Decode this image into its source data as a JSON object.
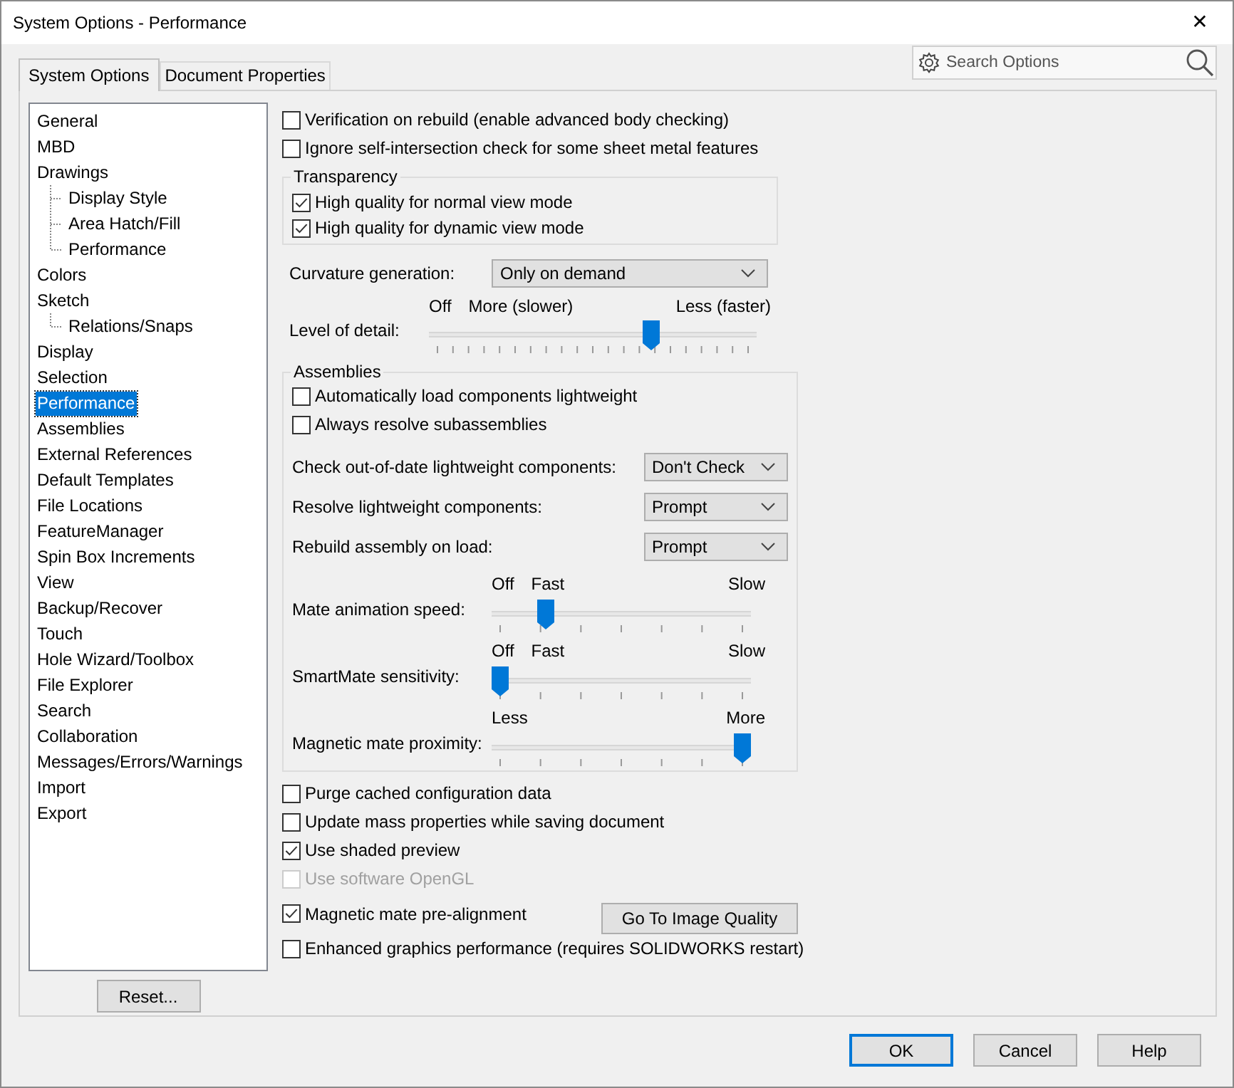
{
  "window": {
    "title": "System Options - Performance",
    "close": "✕"
  },
  "tabs": [
    {
      "label": "System Options",
      "selected": true
    },
    {
      "label": "Document Properties",
      "selected": false
    }
  ],
  "search": {
    "placeholder": "Search Options"
  },
  "tree": [
    {
      "label": "General",
      "selected": false
    },
    {
      "label": "MBD",
      "selected": false
    },
    {
      "label": "Drawings",
      "selected": false,
      "children": [
        {
          "label": "Display Style",
          "selected": false
        },
        {
          "label": "Area Hatch/Fill",
          "selected": false
        },
        {
          "label": "Performance",
          "selected": false
        }
      ]
    },
    {
      "label": "Colors",
      "selected": false
    },
    {
      "label": "Sketch",
      "selected": false,
      "children": [
        {
          "label": "Relations/Snaps",
          "selected": false
        }
      ]
    },
    {
      "label": "Display",
      "selected": false
    },
    {
      "label": "Selection",
      "selected": false
    },
    {
      "label": "Performance",
      "selected": true
    },
    {
      "label": "Assemblies",
      "selected": false
    },
    {
      "label": "External References",
      "selected": false
    },
    {
      "label": "Default Templates",
      "selected": false
    },
    {
      "label": "File Locations",
      "selected": false
    },
    {
      "label": "FeatureManager",
      "selected": false
    },
    {
      "label": "Spin Box Increments",
      "selected": false
    },
    {
      "label": "View",
      "selected": false
    },
    {
      "label": "Backup/Recover",
      "selected": false
    },
    {
      "label": "Touch",
      "selected": false
    },
    {
      "label": "Hole Wizard/Toolbox",
      "selected": false
    },
    {
      "label": "File Explorer",
      "selected": false
    },
    {
      "label": "Search",
      "selected": false
    },
    {
      "label": "Collaboration",
      "selected": false
    },
    {
      "label": "Messages/Errors/Warnings",
      "selected": false
    },
    {
      "label": "Import",
      "selected": false
    },
    {
      "label": "Export",
      "selected": false
    }
  ],
  "reset_button": "Reset...",
  "top_checkboxes": [
    {
      "label": "Verification on rebuild (enable advanced body checking)",
      "checked": false
    },
    {
      "label": "Ignore self-intersection check for some sheet metal features",
      "checked": false
    }
  ],
  "transparency": {
    "title": "Transparency",
    "checkboxes": [
      {
        "label": "High quality for normal view mode",
        "checked": true
      },
      {
        "label": "High quality for dynamic view mode",
        "checked": true
      }
    ]
  },
  "curvature": {
    "label": "Curvature generation:",
    "value": "Only on demand"
  },
  "level_of_detail": {
    "label": "Level of detail:",
    "left_labels": [
      "Off",
      "More (slower)"
    ],
    "right_label": "Less (faster)",
    "level": 0.69
  },
  "assemblies": {
    "title": "Assemblies",
    "checkboxes": [
      {
        "label": "Automatically load components lightweight",
        "checked": false
      },
      {
        "label": "Always resolve subassemblies",
        "checked": false
      }
    ],
    "dropdowns": [
      {
        "label": "Check out-of-date lightweight components:",
        "value": "Don't Check"
      },
      {
        "label": "Resolve lightweight components:",
        "value": "Prompt"
      },
      {
        "label": "Rebuild assembly on load:",
        "value": "Prompt"
      }
    ],
    "sliders": [
      {
        "label": "Mate animation speed:",
        "left_labels": [
          "Off",
          "Fast"
        ],
        "right_label": "Slow",
        "level": 0.19
      },
      {
        "label": "SmartMate sensitivity:",
        "left_labels": [
          "Off",
          "Fast"
        ],
        "right_label": "Slow",
        "level": 0.0
      },
      {
        "label": "Magnetic mate proximity:",
        "left_labels": [
          "Less"
        ],
        "right_label": "More",
        "level": 1.0
      }
    ]
  },
  "bottom_checkboxes": [
    {
      "label": "Purge cached configuration data",
      "checked": false,
      "disabled": false
    },
    {
      "label": "Update mass properties while saving document",
      "checked": false,
      "disabled": false
    },
    {
      "label": "Use shaded preview",
      "checked": true,
      "disabled": false
    },
    {
      "label": "Use software OpenGL",
      "checked": false,
      "disabled": true
    },
    {
      "label": "Magnetic mate pre-alignment",
      "checked": true,
      "disabled": false,
      "button": "Go To Image Quality"
    },
    {
      "label": "Enhanced graphics performance (requires SOLIDWORKS restart)",
      "checked": false,
      "disabled": false
    }
  ],
  "buttons": [
    {
      "label": "OK",
      "default": true
    },
    {
      "label": "Cancel",
      "default": false
    },
    {
      "label": "Help",
      "default": false
    }
  ]
}
